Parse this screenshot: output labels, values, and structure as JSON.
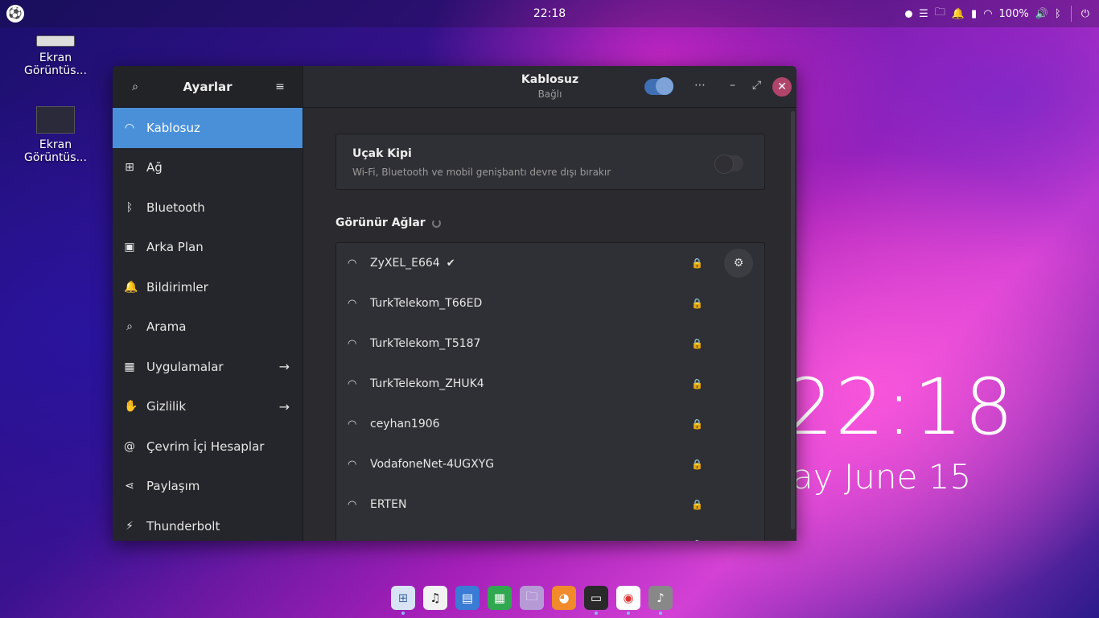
{
  "topbar": {
    "clock": "22:18",
    "battery": "100%"
  },
  "desktop": {
    "icons": [
      {
        "label_line1": "Ekran",
        "label_line2": "Görüntüs..."
      },
      {
        "label_line1": "Ekran",
        "label_line2": "Görüntüs..."
      }
    ],
    "clock": "22:18",
    "date": "ay June 15"
  },
  "sidebar": {
    "title": "Ayarlar",
    "items": [
      {
        "label": "Kablosuz",
        "icon": "wifi-icon"
      },
      {
        "label": "Ağ",
        "icon": "network-icon"
      },
      {
        "label": "Bluetooth",
        "icon": "bluetooth-icon"
      },
      {
        "label": "Arka Plan",
        "icon": "background-icon"
      },
      {
        "label": "Bildirimler",
        "icon": "bell-icon"
      },
      {
        "label": "Arama",
        "icon": "search-icon"
      },
      {
        "label": "Uygulamalar",
        "icon": "apps-icon"
      },
      {
        "label": "Gizlilik",
        "icon": "hand-icon"
      },
      {
        "label": "Çevrim İçi Hesaplar",
        "icon": "at-icon"
      },
      {
        "label": "Paylaşım",
        "icon": "share-icon"
      },
      {
        "label": "Thunderbolt",
        "icon": "thunderbolt-icon"
      }
    ]
  },
  "header": {
    "title": "Kablosuz",
    "subtitle": "Bağlı"
  },
  "airplane": {
    "title": "Uçak Kipi",
    "description": "Wi-Fi, Bluetooth ve mobil genişbantı devre dışı bırakır"
  },
  "networks": {
    "section_title": "Görünür Ağlar",
    "items": [
      {
        "name": "ZyXEL_E664",
        "connected": true
      },
      {
        "name": "TurkTelekom_T66ED"
      },
      {
        "name": "TurkTelekom_T5187"
      },
      {
        "name": "TurkTelekom_ZHUK4"
      },
      {
        "name": "ceyhan1906"
      },
      {
        "name": "VodafoneNet-4UGXYG"
      },
      {
        "name": "ERTEN"
      },
      {
        "name": ""
      }
    ]
  },
  "colors": {
    "accent": "#4a90d9",
    "close": "#b0446a"
  }
}
